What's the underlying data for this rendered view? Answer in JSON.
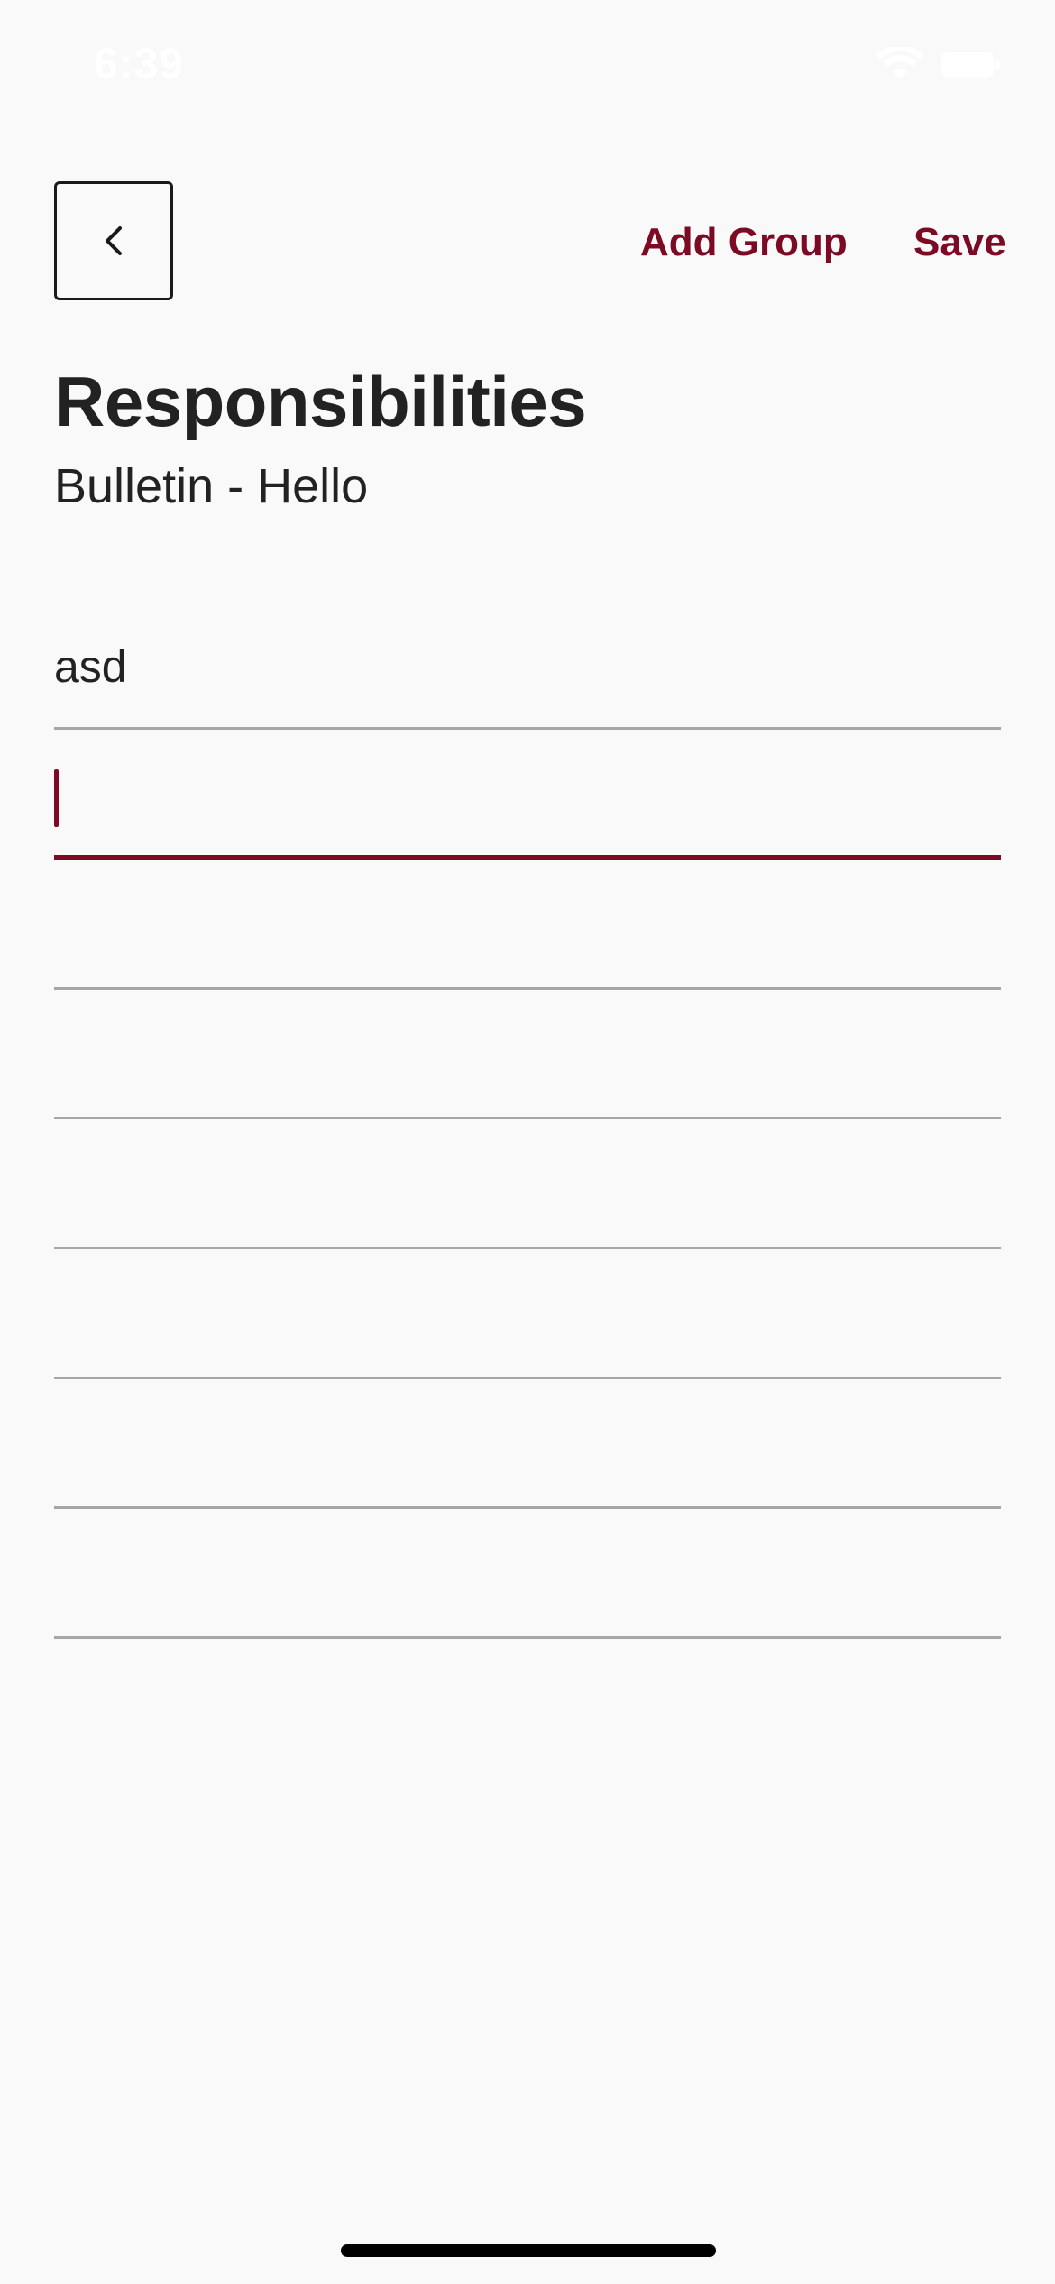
{
  "status_bar": {
    "time": "6:39",
    "icons": [
      "wifi-icon",
      "battery-icon"
    ]
  },
  "header": {
    "back_icon": "chevron-left-icon",
    "add_group_label": "Add Group",
    "save_label": "Save"
  },
  "page": {
    "title": "Responsibilities",
    "subtitle": "Bulletin - Hello"
  },
  "responsibilities": {
    "items": [
      "asd",
      "",
      "",
      "",
      "",
      "",
      "",
      ""
    ],
    "active_index": 1
  },
  "colors": {
    "accent": "#7d0a24",
    "text": "#222222",
    "divider": "#a6a6a6",
    "background": "#f9f9f9"
  }
}
